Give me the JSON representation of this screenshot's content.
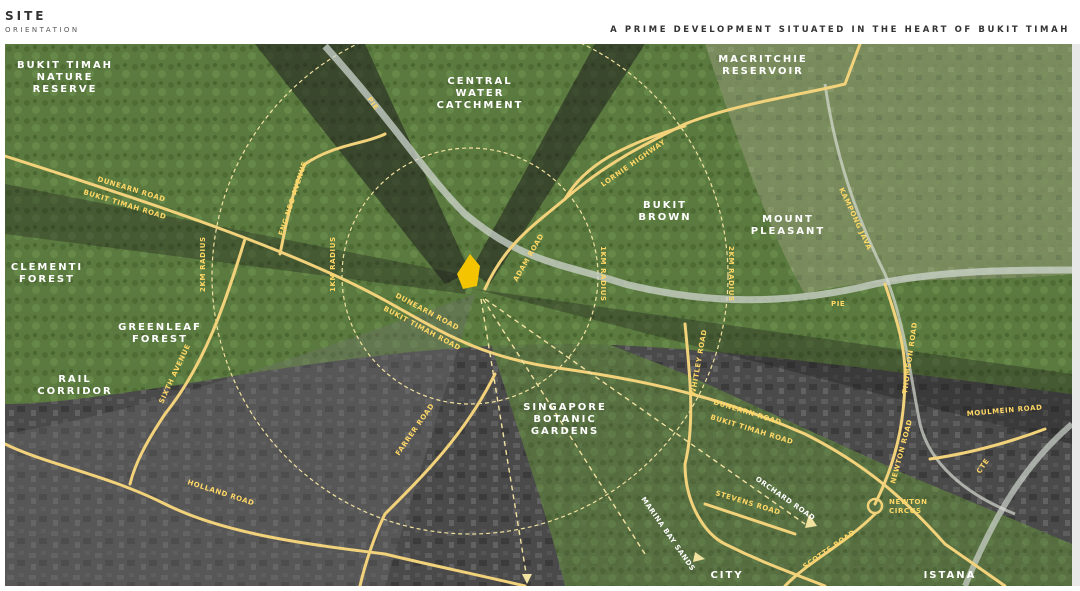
{
  "header": {
    "title": "SITE",
    "subtitle": "ORIENTATION",
    "tagline": "A PRIME DEVELOPMENT SITUATED IN THE HEART OF BUKIT TIMAH"
  },
  "colors": {
    "green_zone": "#5a7a3a",
    "dark_zone": "#2b2b2b",
    "road": "#f2d27a",
    "expressway": "#cfd6cf",
    "site": "#f5c400",
    "circle": "#f2e2a0"
  },
  "places": {
    "bukit_timah_nature_reserve": [
      "BUKIT TIMAH",
      "NATURE",
      "RESERVE"
    ],
    "central_water_catchment": [
      "CENTRAL",
      "WATER",
      "CATCHMENT"
    ],
    "macritchie_reservoir": [
      "MACRITCHIE",
      "RESERVOIR"
    ],
    "bukit_brown": [
      "BUKIT",
      "BROWN"
    ],
    "mount_pleasant": [
      "MOUNT",
      "PLEASANT"
    ],
    "clementi_forest": [
      "CLEMENTI",
      "FOREST"
    ],
    "greenleaf_forest": [
      "GREENLEAF",
      "FOREST"
    ],
    "rail_corridor": [
      "RAIL",
      "CORRIDOR"
    ],
    "singapore_botanic_gardens": [
      "SINGAPORE",
      "BOTANIC",
      "GARDENS"
    ],
    "city": "CITY",
    "istana": "ISTANA"
  },
  "roads": {
    "dunearn_road": "DUNEARN ROAD",
    "bukit_timah_road": "BUKIT TIMAH ROAD",
    "eng_neo_avenue": "ENG NEO AVENUE",
    "pie": "PIE",
    "adam_road": "ADAM ROAD",
    "lornie_highway": "LORNIE HIGHWAY",
    "sixth_avenue": "SIXTH AVENUE",
    "farrer_road": "FARRER ROAD",
    "holland_road": "HOLLAND ROAD",
    "whitley_road": "WHITLEY ROAD",
    "stevens_road": "STEVENS ROAD",
    "orchard_road": "ORCHARD ROAD",
    "scotts_road": "SCOTTS ROAD",
    "marina_bay_sands": "MARINA BAY SANDS",
    "newton_road": "NEWTON ROAD",
    "thomson_road": "THOMSON ROAD",
    "moulmein_road": "MOULMEIN ROAD",
    "newton_circus": [
      "NEWTON",
      "CIRCUS"
    ],
    "cte": "CTE",
    "kampong_java": "KAMPONG JAVA"
  },
  "radii": {
    "one_km": "1KM RADIUS",
    "two_km": "2KM RADIUS"
  }
}
